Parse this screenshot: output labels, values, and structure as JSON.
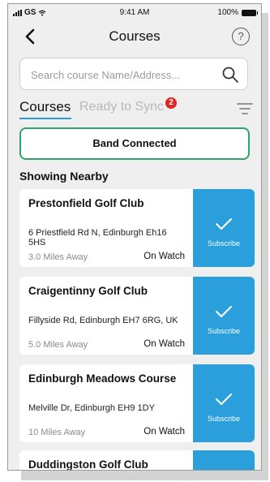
{
  "status": {
    "carrier": "GS",
    "time": "9:41 AM",
    "battery": "100%"
  },
  "header": {
    "title": "Courses",
    "help": "?"
  },
  "search": {
    "placeholder": "Search course Name/Address..."
  },
  "tabs": {
    "active": "Courses",
    "inactive": "Ready to Sync",
    "badge": "2"
  },
  "band": {
    "label": "Band Connected"
  },
  "section": {
    "title": "Showing Nearby"
  },
  "courses": [
    {
      "name": "Prestonfield Golf Club",
      "address": "6 Priestfield Rd N, Edinburgh Eh16 5HS",
      "distance": "3.0 Miles Away",
      "watch": "On Watch",
      "action": "Subscribe"
    },
    {
      "name": "Craigentinny Golf Club",
      "address": "Fillyside Rd, Edinburgh EH7 6RG, UK",
      "distance": "5.0 Miles Away",
      "watch": "On Watch",
      "action": "Subscribe"
    },
    {
      "name": "Edinburgh Meadows Course",
      "address": "Melville Dr, Edinburgh EH9 1DY",
      "distance": "10 Miles Away",
      "watch": "On Watch",
      "action": "Subscribe"
    },
    {
      "name": "Duddingston Golf Club"
    }
  ],
  "colors": {
    "accent": "#2a9fdb",
    "band_border": "#2fa36b",
    "badge": "#e02424",
    "background": "#efefef"
  },
  "icons": [
    "signal-icon",
    "wifi-icon",
    "battery-icon",
    "back-chevron-icon",
    "help-icon",
    "search-icon",
    "filter-icon",
    "check-icon"
  ]
}
